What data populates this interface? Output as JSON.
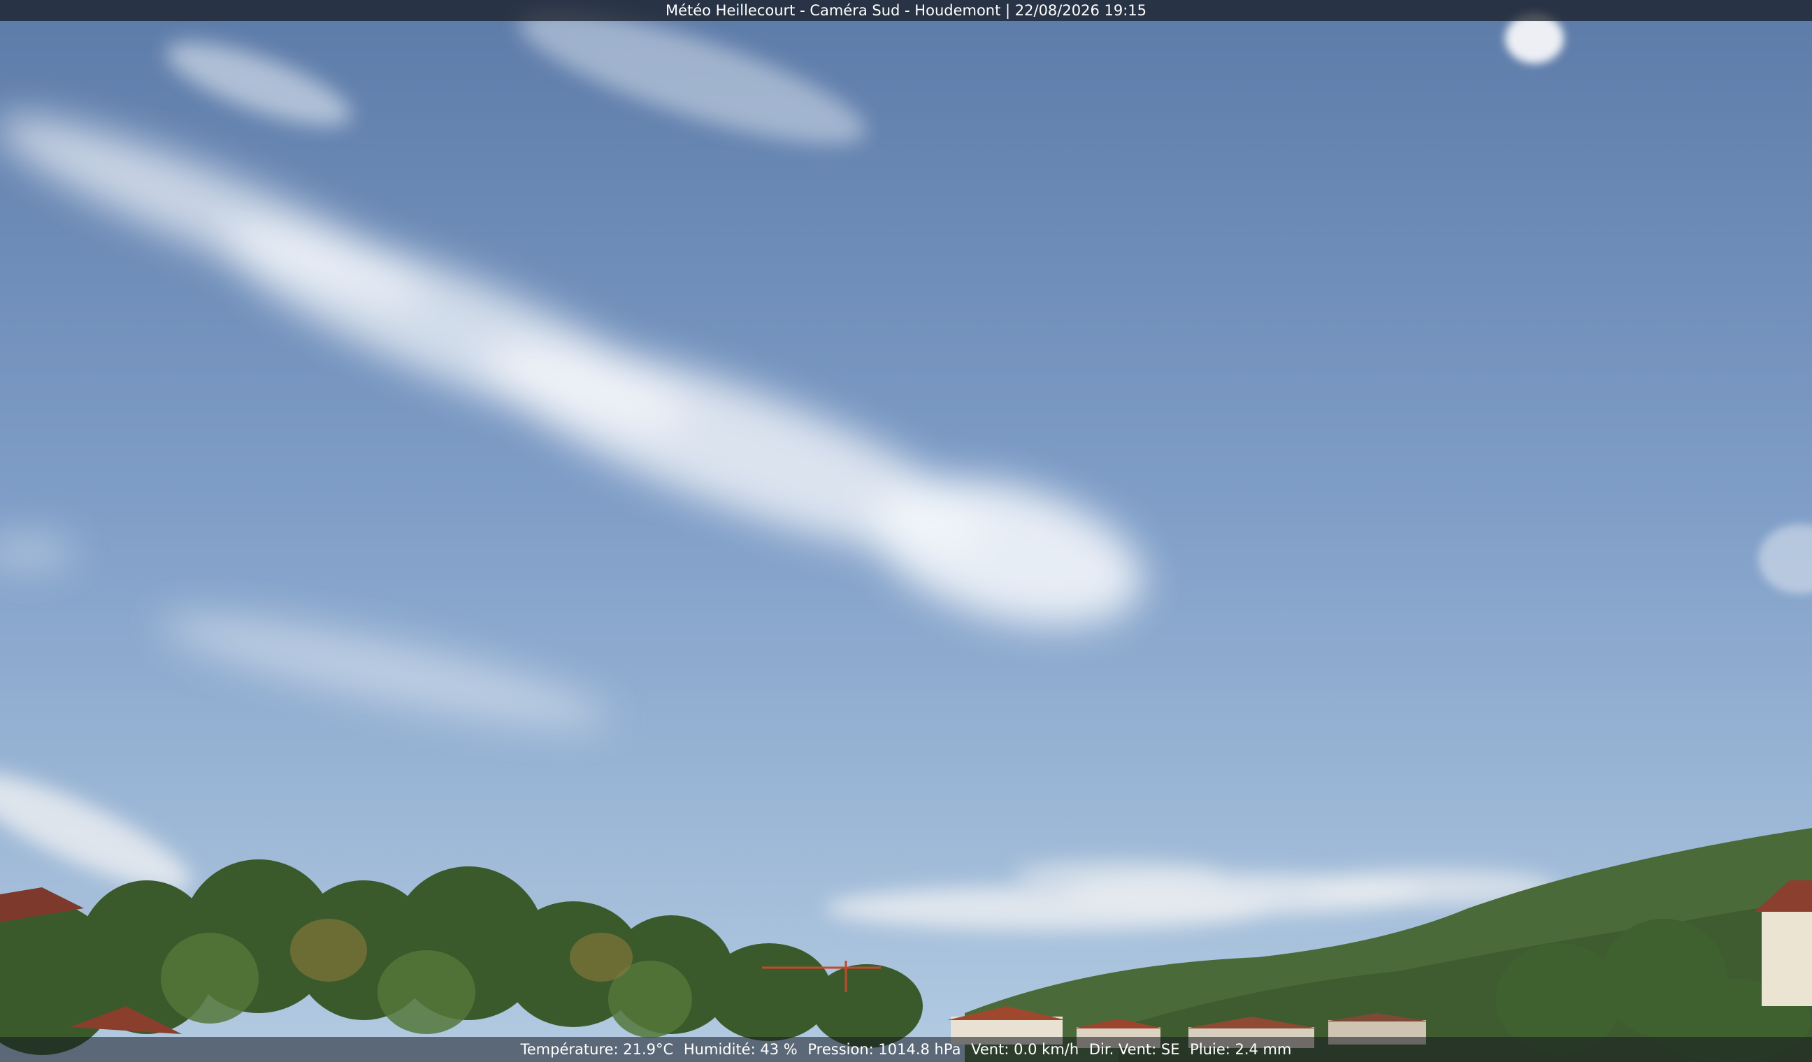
{
  "header": {
    "title": "Météo Heillecourt - Caméra Sud - Houdemont | 22/08/2026 19:15"
  },
  "weather": {
    "temperature": "Température: 21.9°C",
    "humidity": "Humidité: 43 %",
    "pressure": "Pression: 1014.8 hPa",
    "wind": "Vent: 0.0 km/h",
    "wind_direction": "Dir. Vent: SE",
    "rain": "Pluie: 2.4 mm"
  },
  "colors": {
    "sky_top": "#5d7ba8",
    "sky_bottom": "#a9c4de",
    "cloud": "#f2f5f9",
    "trees": "#3c5a2b",
    "roof": "#a0482e"
  }
}
